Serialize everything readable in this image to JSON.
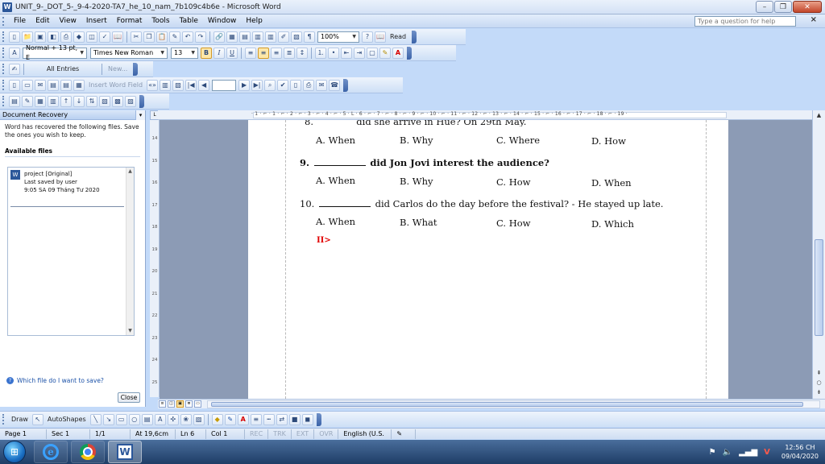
{
  "window": {
    "title": "UNIT_9-_DOT_5-_9-4-2020-TA7_he_10_nam_7b109c4b6e - Microsoft Word",
    "word_icon_letter": "W"
  },
  "menu": {
    "items": [
      "File",
      "Edit",
      "View",
      "Insert",
      "Format",
      "Tools",
      "Table",
      "Window",
      "Help"
    ],
    "help_placeholder": "Type a question for help"
  },
  "toolbar_standard": {
    "zoom": "100%",
    "read_label": "Read"
  },
  "toolbar_formatting": {
    "style": "Normal + 13 pt, E",
    "font": "Times New Roman",
    "size": "13"
  },
  "toolbar_autotext": {
    "entries": "All Entries",
    "new_label": "New..."
  },
  "toolbar_mailmerge": {
    "insert_word_field": "Insert Word Field"
  },
  "taskpane": {
    "title": "Document Recovery",
    "message": "Word has recovered the following files.  Save the ones you wish to keep.",
    "section": "Available files",
    "files": [
      {
        "name": "project  [Original]",
        "saved_by": "Last saved by user",
        "time": "9:05 SA 09 Tháng Tư 2020"
      }
    ],
    "help_link": "Which file do I want to save?",
    "close_label": "Close"
  },
  "ruler": {
    "top_numbers": "· 1 · ⌐ · 1 · ⌐ · 2 · ⌐ · 3 · ⌐ · 4 · ⌐ · 5 · L · 6 · ⌐ · 7 · ⌐ · 8 · ⌐ · 9 · ⌐ · 10 · ⌐ · 11 · ⌐ · 12 · ⌐ · 13 · ⌐ · 14 · ⌐ · 15 · ⌐ · 16 · ⌐ · 17 · ⌐ · 18 · ⌐ · 19 ·",
    "left_numbers": [
      "14",
      "15",
      "16",
      "17",
      "18",
      "19",
      "20",
      "21",
      "22",
      "23",
      "24",
      "25"
    ]
  },
  "document": {
    "cut_line": "8. ________ did she arrive in Hue? On 29th May.",
    "questions": [
      {
        "number": "9.",
        "text": "did Jon Jovi interest the audience?",
        "options": [
          "A. When",
          "B. Why",
          "C. How",
          "D. When"
        ]
      },
      {
        "number": "10.",
        "text": "did Carlos do the day before the festival? - He stayed up late.",
        "options": [
          "A. When",
          "B. What",
          "C. How",
          "D. Which"
        ]
      }
    ],
    "prev_options": [
      "A. When",
      "B. Why",
      "C. Where",
      "D. How"
    ],
    "section_mark": "II>"
  },
  "drawbar": {
    "draw_label": "Draw",
    "autoshapes_label": "AutoShapes"
  },
  "status": {
    "page": "Page 1",
    "sec": "Sec 1",
    "pages": "1/1",
    "at": "At 19,6cm",
    "ln": "Ln 6",
    "col": "Col 1",
    "rec": "REC",
    "trk": "TRK",
    "ext": "EXT",
    "ovr": "OVR",
    "lang": "English (U.S."
  },
  "taskbar": {
    "time": "12:56 CH",
    "date": "09/04/2020"
  }
}
